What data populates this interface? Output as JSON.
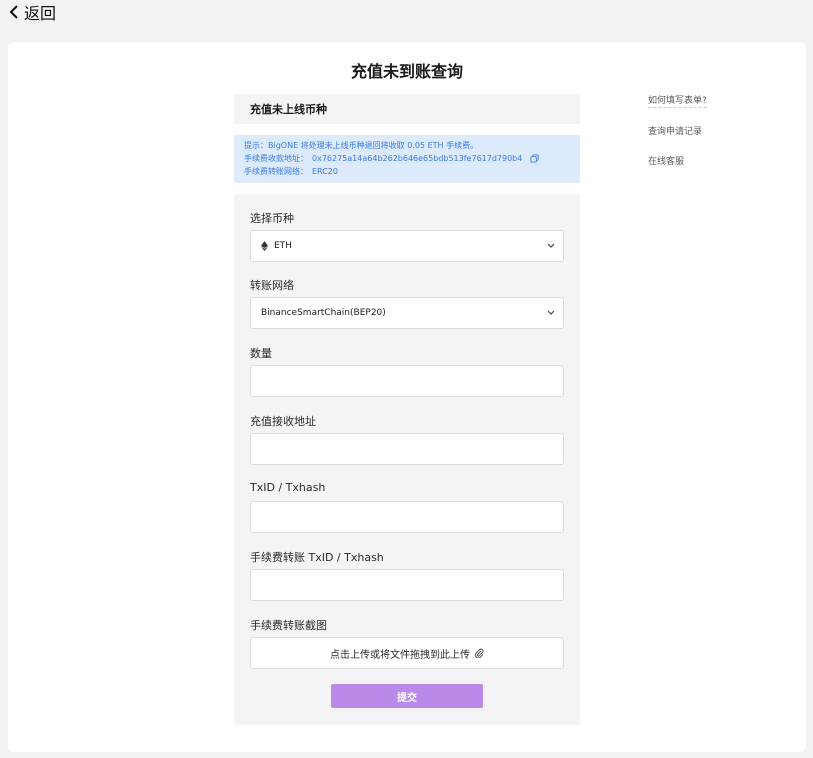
{
  "nav": {
    "back_label": "返回"
  },
  "page": {
    "title": "充值未到账查询"
  },
  "section": {
    "title": "充值未上线币种"
  },
  "notice": {
    "line1": "提示：BigONE 将处理未上线币种退回将收取 0.05 ETH 手续费。",
    "address_label": "手续费收款地址：",
    "address_value": "0x76275a14a64b262b646e65bdb513fe7617d790b4",
    "network_label": "手续费转账网络：",
    "network_value": "ERC20"
  },
  "form": {
    "coin_label": "选择币种",
    "coin_value": "ETH",
    "network_label": "转账网络",
    "network_value": "BinanceSmartChain(BEP20)",
    "amount_label": "数量",
    "amount_value": "",
    "address_label": "充值接收地址",
    "address_value": "",
    "txid_label": "TxID / Txhash",
    "txid_value": "",
    "fee_txid_label": "手续费转账 TxID / Txhash",
    "fee_txid_value": "",
    "screenshot_label": "手续费转账截图",
    "upload_text": "点击上传或将文件拖拽到此上传",
    "submit_label": "提交"
  },
  "sidebar": {
    "links": [
      "如何填写表单?",
      "查询申请记录",
      "在线客服"
    ]
  },
  "colors": {
    "accent": "#b98ae8",
    "notice_bg": "#dceafc",
    "notice_text": "#3a7be0"
  },
  "icons": [
    "chevron-left-icon",
    "copy-icon",
    "eth-icon",
    "chevron-down-icon",
    "paperclip-icon"
  ]
}
